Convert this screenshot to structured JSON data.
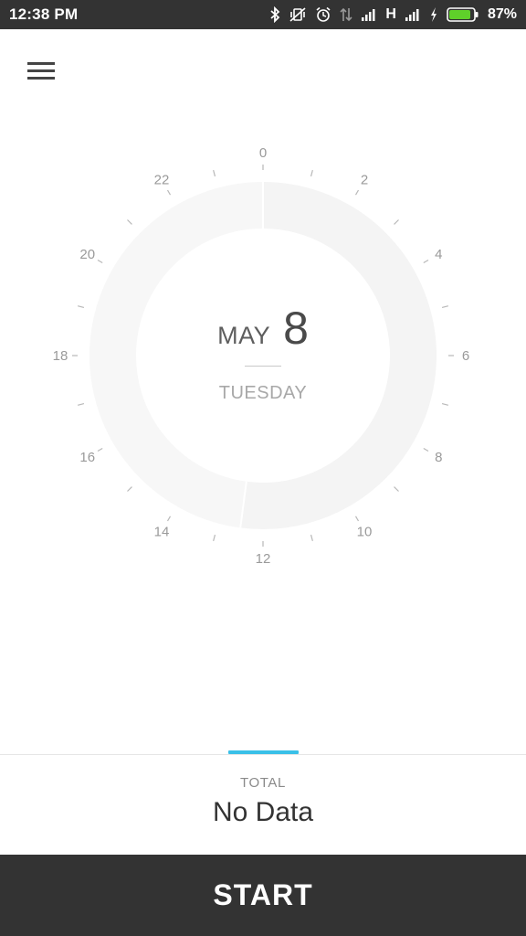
{
  "status_bar": {
    "time": "12:38 PM",
    "network_type": "H",
    "battery_percent": "87%",
    "battery_level": 0.87,
    "icons": [
      "bluetooth-icon",
      "vibrate-icon",
      "alarm-icon",
      "data-arrows-icon",
      "signal-icon",
      "signal-icon",
      "charging-icon",
      "battery-icon"
    ]
  },
  "header": {
    "menu_icon": "menu-icon"
  },
  "dial": {
    "hour_labels": [
      "0",
      "2",
      "4",
      "6",
      "8",
      "10",
      "12",
      "14",
      "16",
      "18",
      "20",
      "22"
    ],
    "arc_boundary_hour": 12.5,
    "colors": {
      "ring_light": "#f4f4f4",
      "ring_lighter": "#f7f7f7",
      "tick": "#b8b8b8"
    }
  },
  "date": {
    "month": "MAY",
    "day": "8",
    "weekday": "TUESDAY"
  },
  "summary": {
    "label": "TOTAL",
    "value": "No Data",
    "accent_color": "#3ac0e8"
  },
  "action": {
    "start_label": "START"
  }
}
